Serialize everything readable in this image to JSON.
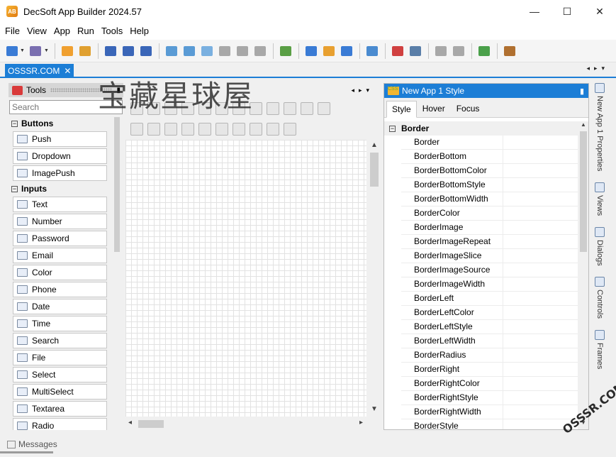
{
  "window": {
    "app_icon_text": "AB",
    "title": "DecSoft App Builder 2024.57",
    "controls": [
      "—",
      "☐",
      "✕"
    ]
  },
  "menu": [
    "File",
    "View",
    "App",
    "Run",
    "Tools",
    "Help"
  ],
  "toolbar": {
    "icon_colors": [
      "#3a7bd5",
      "#7a6fb0",
      "#f0a030",
      "#e0a030",
      "#3a66b8",
      "#3a66b8",
      "#3a66b8",
      "#5a9bd5",
      "#5a9bd5",
      "#7ab0e0",
      "#a8a8a8",
      "#a8a8a8",
      "#a8a8a8",
      "#5a9f45",
      "#3a7bd5",
      "#e8a030",
      "#3a7bd5",
      "#4a8bd0",
      "#d04040",
      "#5a7ea8",
      "#a8a8a8",
      "#a8a8a8",
      "#4aa04a",
      "#b07030"
    ]
  },
  "document_tab": {
    "label": "OSSSR.COM",
    "close": "✕"
  },
  "tab_nav": "◂▸▾",
  "tools_panel": {
    "title": "Tools",
    "pin": "▮",
    "search_placeholder": "Search",
    "groups": [
      {
        "name": "Buttons",
        "items": [
          "Push",
          "Dropdown",
          "ImagePush"
        ]
      },
      {
        "name": "Inputs",
        "items": [
          "Text",
          "Number",
          "Password",
          "Email",
          "Color",
          "Phone",
          "Date",
          "Time",
          "Search",
          "File",
          "Select",
          "MultiSelect",
          "Textarea",
          "Radio"
        ]
      }
    ],
    "collapse_glyph": "−"
  },
  "designer": {
    "nav": "◂▸▾",
    "arrows": {
      "up": "▲",
      "down": "▼",
      "left": "◂",
      "right": "▸"
    }
  },
  "watermark": {
    "text": "宝藏星球屋",
    "corner": "OSSSR.COM"
  },
  "properties_panel": {
    "icon_text": "CSS",
    "title": "New App 1 Style",
    "pin": "▮",
    "tabs": [
      "Style",
      "Hover",
      "Focus"
    ],
    "active_tab": "Style",
    "group": "Border",
    "properties": [
      "Border",
      "BorderBottom",
      "BorderBottomColor",
      "BorderBottomStyle",
      "BorderBottomWidth",
      "BorderColor",
      "BorderImage",
      "BorderImageRepeat",
      "BorderImageSlice",
      "BorderImageSource",
      "BorderImageWidth",
      "BorderLeft",
      "BorderLeftColor",
      "BorderLeftStyle",
      "BorderLeftWidth",
      "BorderRadius",
      "BorderRight",
      "BorderRightColor",
      "BorderRightStyle",
      "BorderRightWidth",
      "BorderStyle"
    ]
  },
  "side_tabs": [
    "New App 1 Properties",
    "Views",
    "Dialogs",
    "Controls",
    "Frames"
  ],
  "status": {
    "messages_label": "Messages"
  }
}
